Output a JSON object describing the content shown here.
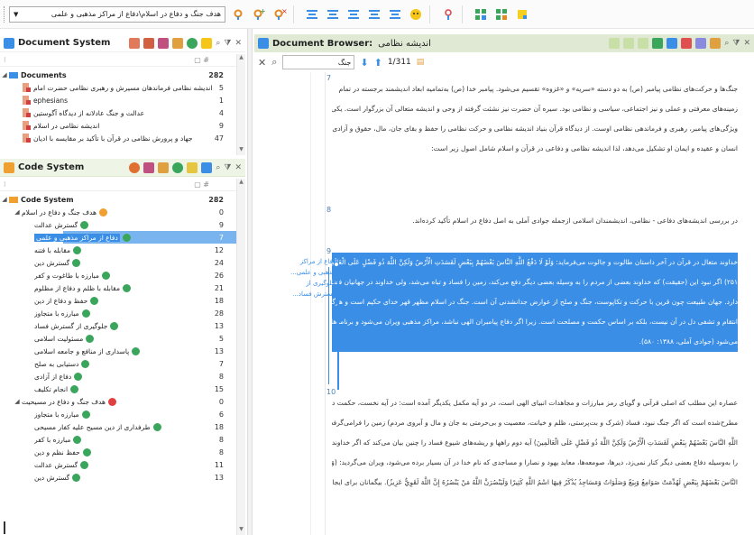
{
  "toolbar": {
    "code_select": "هدف جنگ و دفاع در اسلام\\دفاع از مراکز مذهبی و علمی",
    "icons": [
      "code-select-arrow",
      "code-icon",
      "code-add-icon",
      "code-remove-icon",
      "align-1-icon",
      "align-2-icon",
      "align-3-icon",
      "align-4-icon",
      "align-5-icon",
      "emoji-icon",
      "highlight-icon",
      "copy-code-icon",
      "paste-code-icon",
      "memo-icon"
    ]
  },
  "document_system": {
    "title": "Document System",
    "root": {
      "label": "Documents",
      "count": "282"
    },
    "items": [
      {
        "label": "اندیشه نظامی فرماندهان مسیرش و رهبری نظامی حضرت امام",
        "count": "5"
      },
      {
        "label": "ephesians",
        "count": "1"
      },
      {
        "label": "عدالت و جنگ عادلانه از دیدگاه آگوستین",
        "count": "4"
      },
      {
        "label": "اندیشه نظامی در اسلام",
        "count": "9"
      },
      {
        "label": "جهاد و پرورش نظامی در قرآن با تأکید بر مقایسه با ادیان",
        "count": "47"
      }
    ]
  },
  "code_system": {
    "title": "Code System",
    "root": {
      "label": "Code System",
      "count": "282"
    },
    "items": [
      {
        "level": 1,
        "label": "هدف جنگ و دفاع در اسلام",
        "count": "0",
        "color": "#f0a030"
      },
      {
        "level": 2,
        "label": "گسترش عدالت",
        "count": "9",
        "color": "#3aa65c"
      },
      {
        "level": 2,
        "label": "دفاع از مراکز مذهبی و علمی",
        "count": "7",
        "color": "#3aa65c",
        "selected": true
      },
      {
        "level": 2,
        "label": "مقابله با فتنه",
        "count": "12",
        "color": "#3aa65c"
      },
      {
        "level": 2,
        "label": "گسترش دین",
        "count": "24",
        "color": "#3aa65c"
      },
      {
        "level": 2,
        "label": "مبارزه با طاغوت و کفر",
        "count": "26",
        "color": "#3aa65c"
      },
      {
        "level": 2,
        "label": "مقابله با ظلم و دفاع از مظلوم",
        "count": "21",
        "color": "#3aa65c"
      },
      {
        "level": 2,
        "label": "حفظ و دفاع از دین",
        "count": "18",
        "color": "#3aa65c"
      },
      {
        "level": 2,
        "label": "مبارزه با متجاوز",
        "count": "28",
        "color": "#3aa65c"
      },
      {
        "level": 2,
        "label": "جلوگیری از گسترش فساد",
        "count": "13",
        "color": "#3aa65c"
      },
      {
        "level": 2,
        "label": "مسئولیت اسلامی",
        "count": "5",
        "color": "#3aa65c"
      },
      {
        "level": 2,
        "label": "پاسداری از منافع و جامعه اسلامی",
        "count": "13",
        "color": "#3aa65c"
      },
      {
        "level": 2,
        "label": "دستیابی به صلح",
        "count": "7",
        "color": "#3aa65c"
      },
      {
        "level": 2,
        "label": "دفاع از آزادی",
        "count": "8",
        "color": "#3aa65c"
      },
      {
        "level": 2,
        "label": "انجام تکلیف",
        "count": "15",
        "color": "#3aa65c"
      },
      {
        "level": 1,
        "label": "هدف جنگ و دفاع در مسیحیت",
        "count": "0",
        "color": "#e04040"
      },
      {
        "level": 2,
        "label": "مبارزه با متجاوز",
        "count": "6",
        "color": "#3aa65c"
      },
      {
        "level": 2,
        "label": "طرفداری از دین مسیح علیه کفار مسیحی",
        "count": "18",
        "color": "#3aa65c"
      },
      {
        "level": 2,
        "label": "مبارزه با کفر",
        "count": "8",
        "color": "#3aa65c"
      },
      {
        "level": 2,
        "label": "حفظ نظم و دین",
        "count": "8",
        "color": "#3aa65c"
      },
      {
        "level": 2,
        "label": "گسترش عدالت",
        "count": "11",
        "color": "#3aa65c"
      },
      {
        "level": 2,
        "label": "گسترش دین",
        "count": "13",
        "color": "#3aa65c"
      }
    ]
  },
  "browser": {
    "title": "Document Browser:",
    "doc_name": "اندیشه نظامی",
    "search_value": "جنگ",
    "hits": "1/311",
    "paragraphs": [
      {
        "num": "7",
        "lines": [
          "جنگ‌ها و حرکت‌های نظامی پیامبر (ص) به دو دسته «سریه» و «غزوه» تقسیم می‌شود. پیامبر خدا (ص) به‌تمامیه ابعاد اندیشمند برجسته در تمام",
          "زمینه‌های معرفتی و عملی و نیز اجتماعی، سیاسی و نظامی بود. سیره آن حضرت نیز نشئت گرفته از وحی و اندیشه متعالی آن بزرگوار است. یکی از برجسته‌ترین",
          "ویژگی‌های پیامبر، رهبری و فرماندهی نظامی اوست. از دیدگاه قرآن بنیاد اندیشه نظامی و حرکت نظامی را حفظ و بقای جان، مال، حقوق و آزادی‌های اساسی",
          "انسان و عقیده و ایمان او تشکیل می‌دهد، لذا اندیشه نظامی و دفاعی در قرآن و اسلام شامل اصول زیر است:"
        ]
      },
      {
        "num": "8",
        "lines": [
          "در بررسی اندیشه‌های دفاعی - نظامی، اندیشمندان اسلامی ازجمله جوادی آملی به اصل دفاع در اسلام تأکید کرده‌اند."
        ]
      },
      {
        "num": "9",
        "lines": [
          "خداوند متعال در قرآن در آخر داستان طالوت و جالوت می‌فرماید: وَلَوْ لَا دَفْعُ اللَّهِ النَّاسَ بَعْضَهُمْ بِبَعْضٍ لَفَسَدَتِ الْأَرْضُ وَلَكِنَّ اللَّهَ ذُو فَضْلٍ عَلَى الْعَالَمِينَ (بقره،",
          "۲۵۱) اگر نبود این (حقیقت) که خداوند بعضی از مردم را به وسیله بعضی دیگر دفع می‌کند، زمین را فساد و تباه می‌شد، ولی خداوند در جهانیان فضل و بخشش",
          "دارد. جهان طبیعت چون قرین با حرکت و تکاپوست، جنگ و صلح از عوارض جدانشدنی آن است. جنگ در اسلام مظهر قهر خدای حکیم است و هرگز جنبه",
          "انتقام و تشفی دل در آن نیست، بلکه بر اساس حکمت و مصلحت است. زیرا اگر دفاع پیامبران الهی نباشد، مراکز مذهبی ویران می‌شود و برنامه‌های عالم‌گیر",
          "می‌شود (جوادی آملی، ۱۳۸۸: ۵۸۰)."
        ]
      },
      {
        "num": "10",
        "lines": [
          "عصاره این مطلب که اصلی قرآنی و گویای رمز مبارزات و مجاهدات انبیای الهی است، در دو آیه مکمل یکدیگر آمده است: در آیه نخست، حکمت دفاع چنین",
          "مطرح‌شده است که اگر جنگ نبود، فساد (شرک و بت‌پرستی، ظلم و خیانت، معصیت و بی‌حرمتی به جان و مال و آبروی مردم) زمین را فرامی‌گرفت: (وَلَوْلَا دَفْعُ",
          "اللَّهِ النَّاسَ بَعْضَهُمْ بِبَعْضٍ لَفَسَدَتِ الْأَرْضُ وَلَكِنَّ اللَّهَ ذُو فَضْلٍ عَلَى الْعَالَمِينَ) آیه دوم راهها و ریشه‌های شیوع فساد را چنین بیان می‌کند که اگر خداوند برخی از مردم",
          "را به‌وسیله دفاع بعضی دیگر کنار نمی‌زد، دیرها، صومعه‌ها، معابد یهود و نصارا و مساجدی که نام خدا در آن بسیار برده می‌شود، ویران می‌گردید: (وَلَوْلَا دَفْعُ اللَّهِ",
          "النَّاسَ بَعْضَهُمْ بِبَعْضٍ لَهُدِّمَتْ صَوَامِعُ وَبِيَعٌ وَصَلَوَاتٌ وَمَسَاجِدُ يُذْكَرُ فِيهَا اسْمُ اللَّهِ كَثِيرًا وَلَيَنْصُرَنَّ اللَّهُ مَنْ يَنْصُرُهُ إِنَّ اللَّهَ لَقَوِيٌّ عَزِيزٌ). بیگمانان برای ایجاد فساد در"
        ]
      }
    ],
    "coding_stripe": [
      "دفاع از مراکز مذهبی و علمی...",
      "جلوگیری از گسترش فساد..."
    ]
  }
}
